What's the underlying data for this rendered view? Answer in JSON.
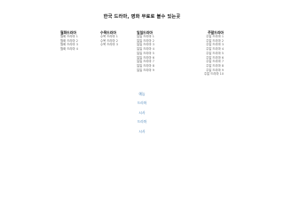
{
  "title": "한국 드라마, 영화 무료로 볼수 있는곳",
  "columns": [
    {
      "heading": "월화드라마",
      "links": [
        "월화 드라마 1",
        "월화 드라마 2",
        "월화 드라마 3",
        "월화 드라마 4"
      ]
    },
    {
      "heading": "수목드라마",
      "links": [
        "수목 드라마 1",
        "수목 드라마 2",
        "수목 드라마 3"
      ]
    },
    {
      "heading": "일일드라마",
      "links": [
        "일일 드라마 1",
        "일일 드라마 2",
        "일일 드라마 3",
        "일일 드라마 4",
        "일일 드라마 5",
        "일일 드라마 6",
        "일일 드라마 7",
        "일일 드라마 8",
        "일일 드라마 9"
      ]
    },
    {
      "heading": "주말드라마",
      "links": [
        "주말 드라마 1",
        "주말 드라마 2",
        "주말 드라마 3",
        "주말 드라마 4",
        "주말 드라마 5",
        "주말 드라마 6",
        "주말 드라마 7",
        "주말 드라마 8",
        "주말 드라마 9",
        "주말 드라마 10"
      ]
    }
  ],
  "bottom_nav": [
    "예능",
    "드라마",
    "시사",
    "드라마",
    "시사"
  ]
}
